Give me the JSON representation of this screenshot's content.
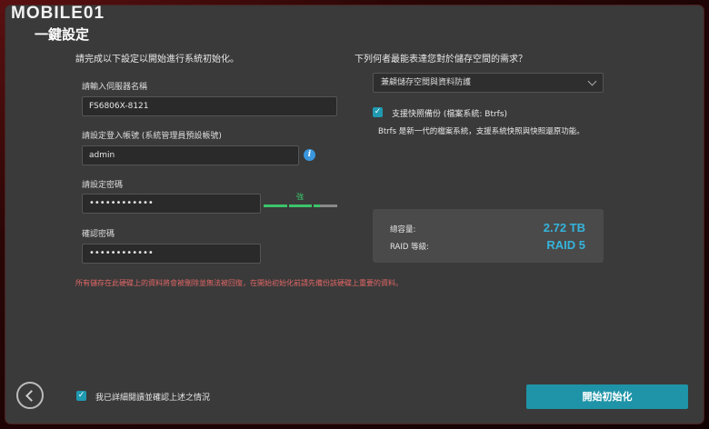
{
  "watermark": "MOBILE01",
  "title": "一鍵設定",
  "left": {
    "lead": "請完成以下設定以開始進行系統初始化。",
    "server_name": {
      "label": "請輸入伺服器名稱",
      "value": "FS6806X-8121"
    },
    "login": {
      "label": "請設定登入帳號 (系統管理員預設帳號)",
      "value": "admin"
    },
    "password": {
      "label": "請設定密碼",
      "value": "••••••••••••"
    },
    "strength": {
      "label": "強",
      "level": 0.75
    },
    "confirm": {
      "label": "確認密碼",
      "value": "••••••••••••"
    },
    "warning": "所有儲存在此硬碟上的資料將會被刪除並無法被回復，在開始初始化前請先備份該硬碟上重要的資料。"
  },
  "right": {
    "lead": "下列何者最能表達您對於儲存空間的需求？",
    "select_value": "兼顧儲存空間與資料防護",
    "snapshot_label": "支援快照備份 (檔案系統: Btrfs)",
    "snapshot_checked": true,
    "desc": "Btrfs 是新一代的檔案系統，支援系統快照與快照還原功能。",
    "capacity_label": "總容量:",
    "capacity_value": "2.72 TB",
    "raid_label": "RAID 等級:",
    "raid_value": "RAID 5"
  },
  "footer": {
    "agree_label": "我已詳細閱讀並確認上述之情況",
    "agree_checked": true,
    "start_label": "開始初始化"
  },
  "icons": {
    "back": "arrow-left-icon",
    "info": "info-icon",
    "checkmark": "checkmark-icon"
  },
  "colors": {
    "accent": "#1f94a8",
    "strength": "#3cc46a",
    "warning": "#e06666",
    "value": "#35b4dc"
  }
}
